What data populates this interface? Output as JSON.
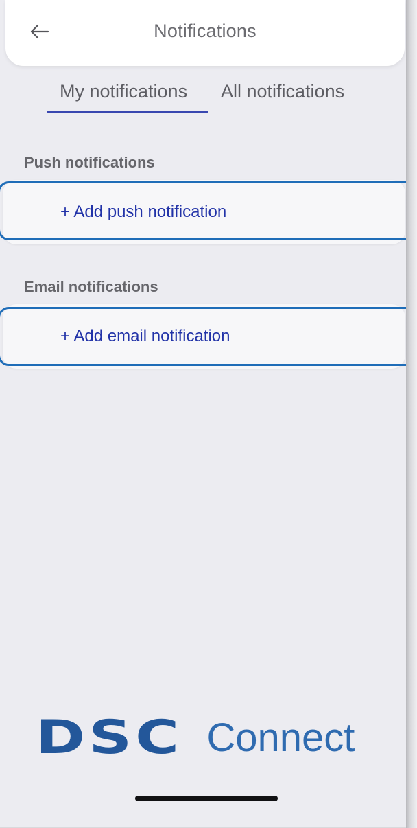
{
  "header": {
    "title": "Notifications",
    "back_icon": "arrow-left-icon"
  },
  "tabs": [
    {
      "label": "My notifications",
      "active": true
    },
    {
      "label": "All notifications",
      "active": false
    }
  ],
  "sections": {
    "push": {
      "label": "Push notifications",
      "action": "+ Add push notification"
    },
    "email": {
      "label": "Email notifications",
      "action": "+ Add email notification"
    }
  },
  "logo": {
    "brand": "DSC",
    "product": "Connect"
  },
  "colors": {
    "accent": "#2233a8",
    "tab_indicator": "#3947b0",
    "highlight_outline": "#1f6db8",
    "logo_blue": "#23579a",
    "background": "#ececf1"
  }
}
